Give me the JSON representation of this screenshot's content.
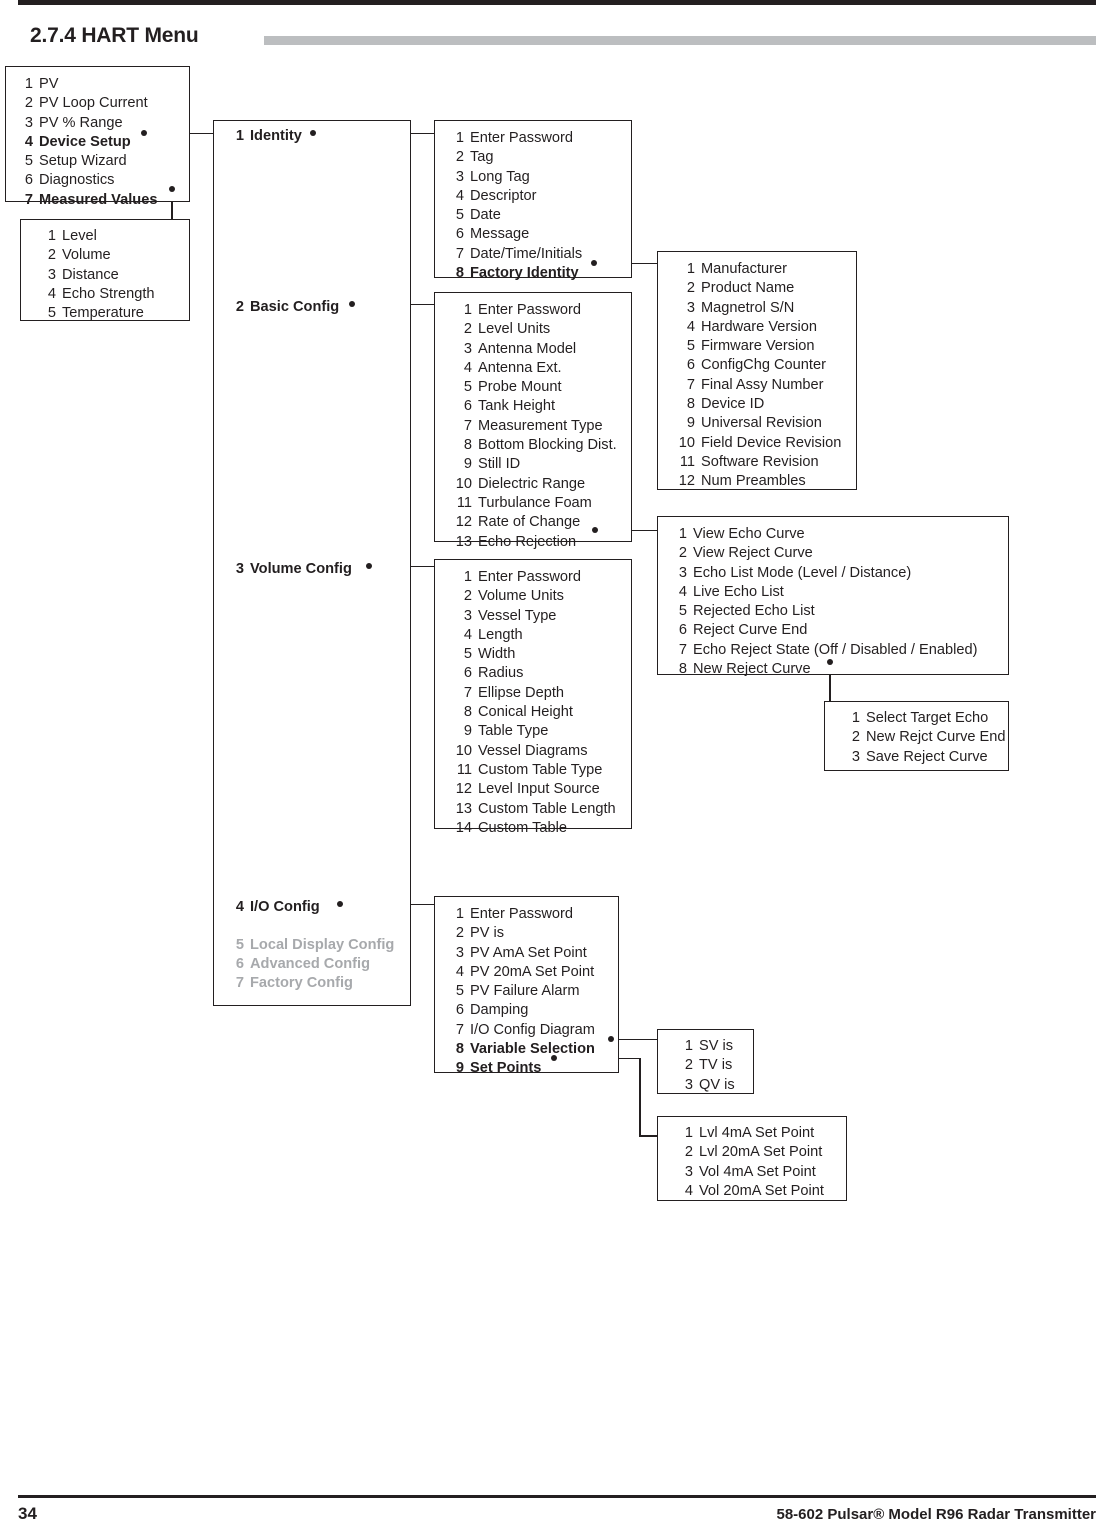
{
  "page": {
    "heading": "2.7.4 HART Menu",
    "footer_page_number": "34",
    "footer_title": "58-602 Pulsar® Model R96 Radar Transmitter",
    "rule_color": "#231f20",
    "heading_bar_color": "#bcbec0",
    "disabled_text_color": "#a7a9ac"
  },
  "boxes": {
    "main_menu": {
      "items": [
        {
          "num": "1",
          "label": "PV",
          "style": "normal"
        },
        {
          "num": "2",
          "label": "PV Loop Current",
          "style": "normal"
        },
        {
          "num": "3",
          "label": "PV % Range",
          "style": "normal"
        },
        {
          "num": "4",
          "label": "Device Setup",
          "style": "bold"
        },
        {
          "num": "5",
          "label": "Setup Wizard",
          "style": "normal"
        },
        {
          "num": "6",
          "label": "Diagnostics",
          "style": "normal"
        },
        {
          "num": "7",
          "label": "Measured Values",
          "style": "bold"
        }
      ]
    },
    "measured_values": {
      "items": [
        {
          "num": "1",
          "label": "Level",
          "style": "normal"
        },
        {
          "num": "2",
          "label": "Volume",
          "style": "normal"
        },
        {
          "num": "3",
          "label": "Distance",
          "style": "normal"
        },
        {
          "num": "4",
          "label": "Echo Strength",
          "style": "normal"
        },
        {
          "num": "5",
          "label": "Temperature",
          "style": "normal"
        }
      ]
    },
    "device_setup": {
      "items": [
        {
          "num": "1",
          "label": "Identity",
          "style": "bold"
        },
        {
          "num": "2",
          "label": "Basic Config",
          "style": "bold"
        },
        {
          "num": "3",
          "label": "Volume Config",
          "style": "bold"
        },
        {
          "num": "4",
          "label": "I/O Config",
          "style": "bold"
        },
        {
          "num": "5",
          "label": "Local Display Config",
          "style": "grey"
        },
        {
          "num": "6",
          "label": "Advanced Config",
          "style": "grey"
        },
        {
          "num": "7",
          "label": "Factory Config",
          "style": "grey"
        }
      ]
    },
    "identity": {
      "items": [
        {
          "num": "1",
          "label": "Enter Password",
          "style": "normal"
        },
        {
          "num": "2",
          "label": "Tag",
          "style": "normal"
        },
        {
          "num": "3",
          "label": "Long Tag",
          "style": "normal"
        },
        {
          "num": "4",
          "label": "Descriptor",
          "style": "normal"
        },
        {
          "num": "5",
          "label": "Date",
          "style": "normal"
        },
        {
          "num": "6",
          "label": "Message",
          "style": "normal"
        },
        {
          "num": "7",
          "label": "Date/Time/Initials",
          "style": "normal"
        },
        {
          "num": "8",
          "label": "Factory Identity",
          "style": "bold"
        }
      ]
    },
    "factory_identity": {
      "items": [
        {
          "num": "1",
          "label": "Manufacturer",
          "style": "normal"
        },
        {
          "num": "2",
          "label": "Product Name",
          "style": "normal"
        },
        {
          "num": "3",
          "label": "Magnetrol S/N",
          "style": "normal"
        },
        {
          "num": "4",
          "label": "Hardware Version",
          "style": "normal"
        },
        {
          "num": "5",
          "label": "Firmware Version",
          "style": "normal"
        },
        {
          "num": "6",
          "label": "ConfigChg Counter",
          "style": "normal"
        },
        {
          "num": "7",
          "label": "Final Assy Number",
          "style": "normal"
        },
        {
          "num": "8",
          "label": "Device ID",
          "style": "normal"
        },
        {
          "num": "9",
          "label": "Universal Revision",
          "style": "normal"
        },
        {
          "num": "10",
          "label": "Field Device Revision",
          "style": "normal"
        },
        {
          "num": "11",
          "label": "Software Revision",
          "style": "normal"
        },
        {
          "num": "12",
          "label": "Num Preambles",
          "style": "normal"
        }
      ]
    },
    "basic_config": {
      "items": [
        {
          "num": "1",
          "label": "Enter Password",
          "style": "normal"
        },
        {
          "num": "2",
          "label": "Level Units",
          "style": "normal"
        },
        {
          "num": "3",
          "label": "Antenna Model",
          "style": "normal"
        },
        {
          "num": "4",
          "label": "Antenna Ext.",
          "style": "normal"
        },
        {
          "num": "5",
          "label": "Probe Mount",
          "style": "normal"
        },
        {
          "num": "6",
          "label": "Tank Height",
          "style": "normal"
        },
        {
          "num": "7",
          "label": "Measurement Type",
          "style": "normal"
        },
        {
          "num": "8",
          "label": "Bottom Blocking Dist.",
          "style": "normal"
        },
        {
          "num": "9",
          "label": "Still ID",
          "style": "normal"
        },
        {
          "num": "10",
          "label": "Dielectric Range",
          "style": "normal"
        },
        {
          "num": "11",
          "label": "Turbulance Foam",
          "style": "normal"
        },
        {
          "num": "12",
          "label": "Rate of Change",
          "style": "normal"
        },
        {
          "num": "13",
          "label": "Echo Rejection",
          "style": "normal"
        }
      ]
    },
    "echo_rejection": {
      "items": [
        {
          "num": "1",
          "label": "View Echo Curve",
          "style": "normal"
        },
        {
          "num": "2",
          "label": "View Reject Curve",
          "style": "normal"
        },
        {
          "num": "3",
          "label": "Echo List Mode (Level / Distance)",
          "style": "normal"
        },
        {
          "num": "4",
          "label": "Live Echo List",
          "style": "normal"
        },
        {
          "num": "5",
          "label": "Rejected Echo List",
          "style": "normal"
        },
        {
          "num": "6",
          "label": "Reject Curve End",
          "style": "normal"
        },
        {
          "num": "7",
          "label": "Echo Reject State (Off / Disabled / Enabled)",
          "style": "normal"
        },
        {
          "num": "8",
          "label": "New Reject Curve",
          "style": "normal"
        }
      ]
    },
    "new_reject_curve": {
      "items": [
        {
          "num": "1",
          "label": "Select Target Echo",
          "style": "normal"
        },
        {
          "num": "2",
          "label": "New Rejct Curve End",
          "style": "normal"
        },
        {
          "num": "3",
          "label": "Save Reject Curve",
          "style": "normal"
        }
      ]
    },
    "volume_config": {
      "items": [
        {
          "num": "1",
          "label": "Enter Password",
          "style": "normal"
        },
        {
          "num": "2",
          "label": "Volume Units",
          "style": "normal"
        },
        {
          "num": "3",
          "label": "Vessel Type",
          "style": "normal"
        },
        {
          "num": "4",
          "label": "Length",
          "style": "normal"
        },
        {
          "num": "5",
          "label": "Width",
          "style": "normal"
        },
        {
          "num": "6",
          "label": "Radius",
          "style": "normal"
        },
        {
          "num": "7",
          "label": "Ellipse Depth",
          "style": "normal"
        },
        {
          "num": "8",
          "label": "Conical Height",
          "style": "normal"
        },
        {
          "num": "9",
          "label": "Table Type",
          "style": "normal"
        },
        {
          "num": "10",
          "label": "Vessel Diagrams",
          "style": "normal"
        },
        {
          "num": "11",
          "label": "Custom Table Type",
          "style": "normal"
        },
        {
          "num": "12",
          "label": "Level Input Source",
          "style": "normal"
        },
        {
          "num": "13",
          "label": "Custom Table Length",
          "style": "normal"
        },
        {
          "num": "14",
          "label": "Custom Table",
          "style": "normal"
        }
      ]
    },
    "io_config": {
      "items": [
        {
          "num": "1",
          "label": "Enter Password",
          "style": "normal"
        },
        {
          "num": "2",
          "label": "PV is",
          "style": "normal"
        },
        {
          "num": "3",
          "label": "PV AmA Set Point",
          "style": "normal"
        },
        {
          "num": "4",
          "label": "PV 20mA Set Point",
          "style": "normal"
        },
        {
          "num": "5",
          "label": "PV Failure Alarm",
          "style": "normal"
        },
        {
          "num": "6",
          "label": "Damping",
          "style": "normal"
        },
        {
          "num": "7",
          "label": "I/O Config Diagram",
          "style": "normal"
        },
        {
          "num": "8",
          "label": "Variable Selection",
          "style": "bold"
        },
        {
          "num": "9",
          "label": "Set Points",
          "style": "bold"
        }
      ]
    },
    "variable_selection": {
      "items": [
        {
          "num": "1",
          "label": "SV is",
          "style": "normal"
        },
        {
          "num": "2",
          "label": "TV is",
          "style": "normal"
        },
        {
          "num": "3",
          "label": "QV is",
          "style": "normal"
        }
      ]
    },
    "set_points": {
      "items": [
        {
          "num": "1",
          "label": "Lvl 4mA Set Point",
          "style": "normal"
        },
        {
          "num": "2",
          "label": "Lvl 20mA Set Point",
          "style": "normal"
        },
        {
          "num": "3",
          "label": "Vol 4mA Set Point",
          "style": "normal"
        },
        {
          "num": "4",
          "label": "Vol 20mA Set Point",
          "style": "normal"
        }
      ]
    }
  }
}
